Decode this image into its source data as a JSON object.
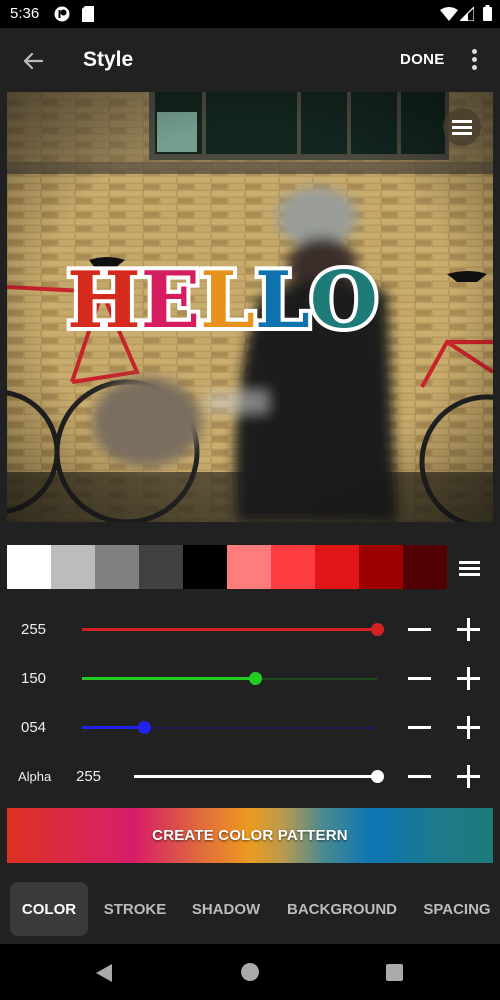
{
  "status_bar": {
    "time": "5:36",
    "left_icons": [
      "notification-icon",
      "sd-card-icon"
    ],
    "right_icons": [
      "wifi-icon",
      "signal-icon",
      "battery-icon"
    ]
  },
  "app_bar": {
    "back_icon": "arrow-left-icon",
    "title": "Style",
    "done_label": "DONE",
    "overflow_icon": "more-vertical-icon"
  },
  "canvas": {
    "photo_description": "Brick wall with red bicycles and blurred person walking",
    "layer_menu_icon": "hamburger-menu-icon",
    "text_layer": {
      "letters": [
        {
          "char": "H",
          "color": "#d42b1c"
        },
        {
          "char": "E",
          "color": "#d51c5e"
        },
        {
          "char": "L",
          "color": "#e8921e"
        },
        {
          "char": "L",
          "color": "#0d72ae"
        },
        {
          "char": "O",
          "color": "#1f7b77"
        }
      ],
      "stroke_color": "#ffffff"
    }
  },
  "palette": {
    "swatches": [
      "#ffffff",
      "#bcbcbc",
      "#808080",
      "#404242",
      "#000000",
      "#ff7c7c",
      "#ff3c40",
      "#e01616",
      "#9c0000",
      "#520004"
    ],
    "menu_icon": "hamburger-menu-icon"
  },
  "sliders": [
    {
      "name": "red",
      "label": "",
      "value": "255",
      "fraction": 1.0,
      "color": "#d32222",
      "track_color": "#5a1a1a"
    },
    {
      "name": "green",
      "label": "",
      "value": "150",
      "fraction": 0.588,
      "color": "#22cc22",
      "track_color": "#1e4a22"
    },
    {
      "name": "blue",
      "label": "",
      "value": "054",
      "fraction": 0.212,
      "color": "#2222ee",
      "track_color": "#1e1e55"
    },
    {
      "name": "alpha",
      "label": "Alpha",
      "value": "255",
      "fraction": 1.0,
      "color": "#ffffff",
      "track_color": "#ffffff"
    }
  ],
  "pattern_button": {
    "label": "CREATE COLOR PATTERN"
  },
  "tabs": [
    {
      "label": "COLOR",
      "active": true
    },
    {
      "label": "STROKE",
      "active": false
    },
    {
      "label": "SHADOW",
      "active": false
    },
    {
      "label": "BACKGROUND",
      "active": false
    },
    {
      "label": "SPACING",
      "active": false
    }
  ],
  "nav_bar": {
    "icons": [
      "nav-back-icon",
      "nav-home-icon",
      "nav-recents-icon"
    ]
  }
}
